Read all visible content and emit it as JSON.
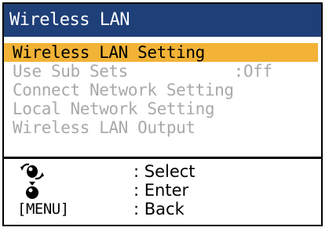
{
  "window": {
    "title": "Wireless LAN"
  },
  "menu": {
    "items": [
      {
        "label": "Wireless LAN Setting",
        "state": "selected"
      },
      {
        "label": "Use Sub Sets           :Off",
        "state": "disabled"
      },
      {
        "label": "Connect Network Setting",
        "state": "disabled"
      },
      {
        "label": "Local Network Setting",
        "state": "disabled"
      },
      {
        "label": "Wireless LAN Output",
        "state": "disabled"
      }
    ]
  },
  "help": {
    "rows": [
      {
        "icon": "rotate-knob-icon",
        "text": ": Select"
      },
      {
        "icon": "push-knob-icon",
        "text": ": Enter"
      },
      {
        "key_label": "[MENU]",
        "text": ": Back"
      }
    ]
  },
  "colors": {
    "title_bar": "#1f3f78",
    "selection": "#f2b336",
    "disabled_text": "#a9a9a9"
  }
}
